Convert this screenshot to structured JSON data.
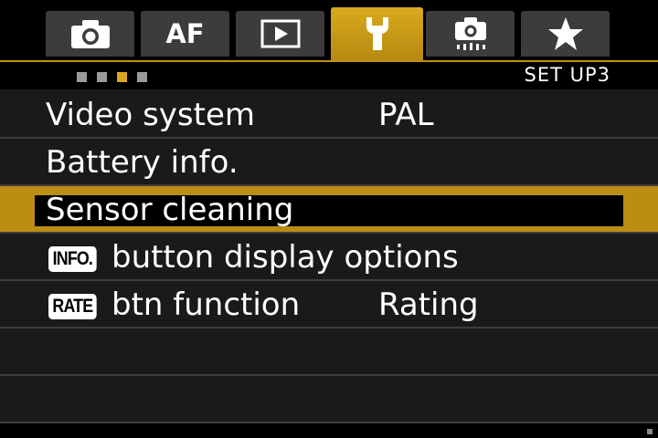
{
  "tabs": [
    {
      "name": "shooting",
      "icon": "camera-icon",
      "active": false
    },
    {
      "name": "af",
      "label": "AF",
      "active": false
    },
    {
      "name": "playback",
      "icon": "play-icon",
      "active": false
    },
    {
      "name": "setup",
      "icon": "wrench-icon",
      "active": true
    },
    {
      "name": "live-view",
      "icon": "live-view-camera-icon",
      "active": false
    },
    {
      "name": "my-menu",
      "icon": "star-icon",
      "active": false
    }
  ],
  "page_indicator": {
    "pages": 4,
    "current": 3
  },
  "page_label": "SET UP3",
  "menu_items": [
    {
      "label": "Video system",
      "value": "PAL",
      "selected": false
    },
    {
      "label": "Battery info.",
      "value": "",
      "selected": false
    },
    {
      "label": "Sensor cleaning",
      "value": "",
      "selected": true
    },
    {
      "icon_text": "INFO.",
      "label": "button display options",
      "value": "",
      "selected": false
    },
    {
      "icon_text": "RATE",
      "label": "btn function",
      "value": "Rating",
      "selected": false
    }
  ],
  "colors": {
    "accent": "#c99a18",
    "background": "#1a1a1a",
    "selected_fill": "#000000"
  }
}
